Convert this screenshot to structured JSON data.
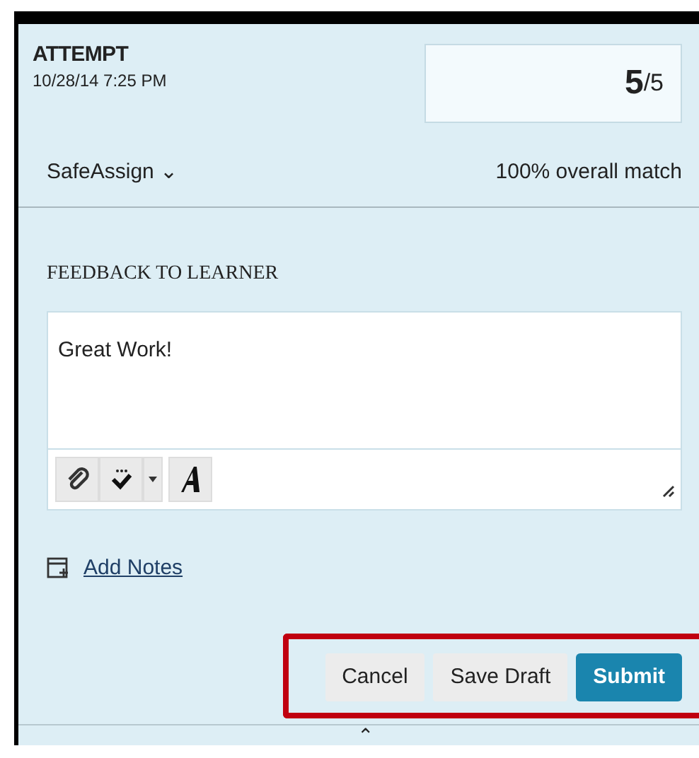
{
  "attempt": {
    "label": "ATTEMPT",
    "date": "10/28/14 7:25 PM"
  },
  "score": {
    "value": "5",
    "total": "/5"
  },
  "safeassign": {
    "label": "SafeAssign",
    "caret": "⌄",
    "match": "100% overall match"
  },
  "feedback": {
    "label": "FEEDBACK TO LEARNER",
    "value": "Great Work!"
  },
  "add_notes": "Add Notes",
  "action_bar": {
    "highlighted": true,
    "buttons": [
      {
        "label": "Cancel",
        "kind": "secondary"
      },
      {
        "label": "Save Draft",
        "kind": "secondary"
      },
      {
        "label": "Submit",
        "kind": "primary"
      }
    ]
  },
  "collapse_handle": "⌃"
}
